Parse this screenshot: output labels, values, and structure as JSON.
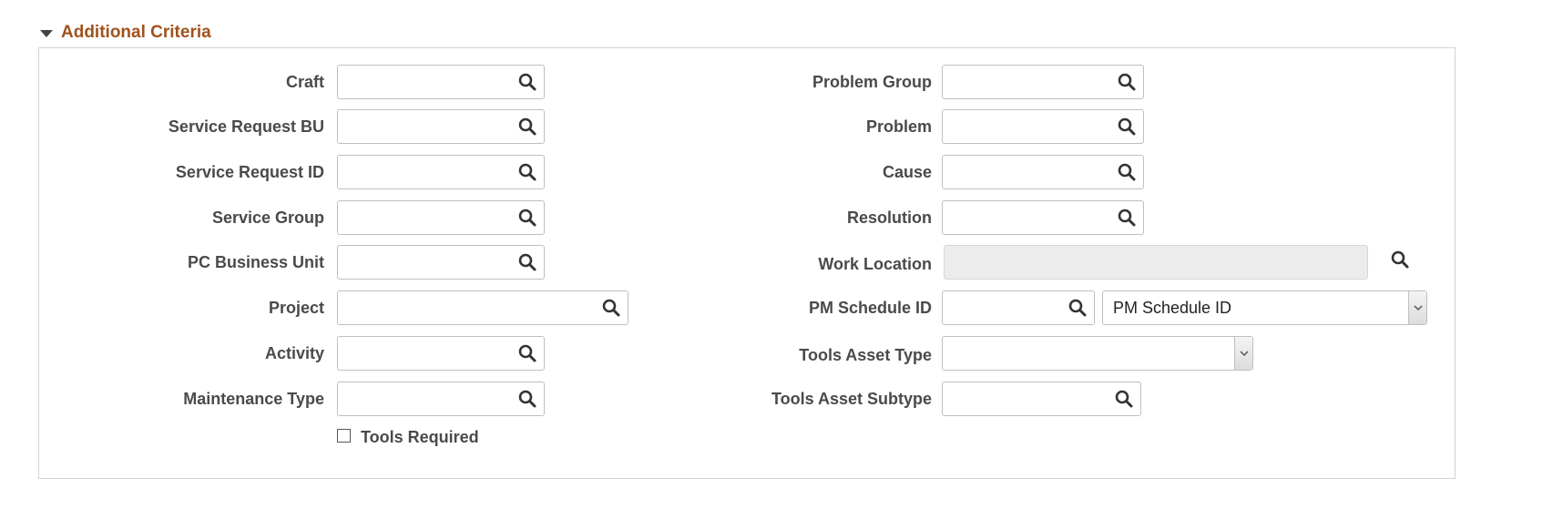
{
  "section": {
    "title": "Additional Criteria"
  },
  "left_fields": [
    {
      "label": "Craft",
      "value": ""
    },
    {
      "label": "Service Request BU",
      "value": ""
    },
    {
      "label": "Service Request ID",
      "value": ""
    },
    {
      "label": "Service Group",
      "value": ""
    },
    {
      "label": "PC Business Unit",
      "value": ""
    },
    {
      "label": "Project",
      "value": ""
    },
    {
      "label": "Activity",
      "value": ""
    },
    {
      "label": "Maintenance Type",
      "value": ""
    }
  ],
  "right_fields": [
    {
      "label": "Problem Group",
      "value": ""
    },
    {
      "label": "Problem",
      "value": ""
    },
    {
      "label": "Cause",
      "value": ""
    },
    {
      "label": "Resolution",
      "value": ""
    },
    {
      "label": "Work Location",
      "value": ""
    },
    {
      "label": "PM Schedule ID",
      "value": "",
      "select_value": "PM Schedule ID"
    },
    {
      "label": "Tools Asset Type",
      "select_value": ""
    },
    {
      "label": "Tools Asset Subtype",
      "value": ""
    }
  ],
  "checkbox": {
    "label": "Tools Required",
    "checked": false
  },
  "icons": {
    "lookup": "search-icon",
    "dropdown": "chevron-down-icon",
    "section_toggle": "triangle-down-icon"
  },
  "colors": {
    "section_title": "#a0521c",
    "label": "#4a4a4a",
    "border": "#bfbfbf",
    "disabled_bg": "#ececec"
  }
}
